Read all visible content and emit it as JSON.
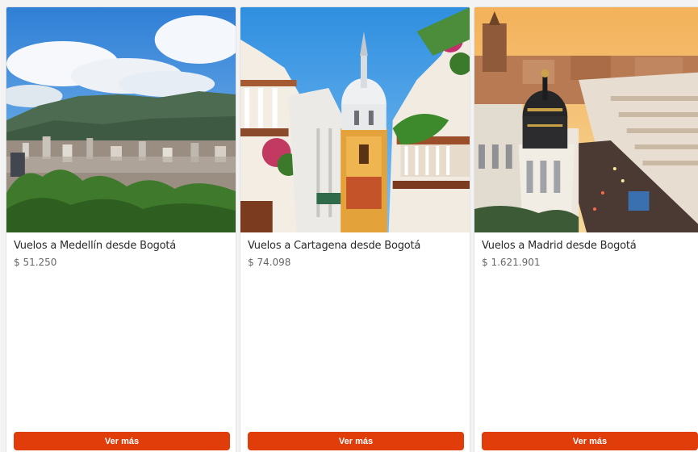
{
  "theme": {
    "accent": "#e13d0b"
  },
  "cards": [
    {
      "title": "Vuelos a Medellín desde Bogotá",
      "price": "$ 51.250",
      "button_label": "Ver más"
    },
    {
      "title": "Vuelos a Cartagena desde Bogotá",
      "price": "$ 74.098",
      "button_label": "Ver más"
    },
    {
      "title": "Vuelos a Madrid desde Bogotá",
      "price": "$ 1.621.901",
      "button_label": "Ver más"
    }
  ]
}
